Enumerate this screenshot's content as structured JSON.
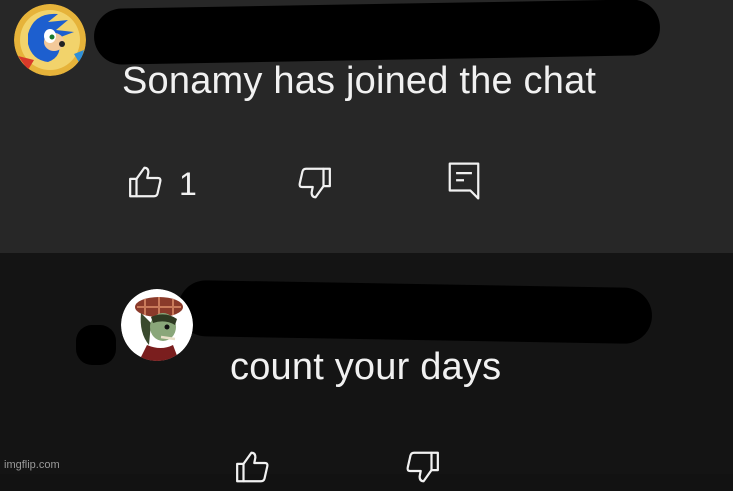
{
  "comments": [
    {
      "text": "Sonamy has joined the chat",
      "like_count": "1",
      "avatar_icon": "sonic-avatar-icon"
    },
    {
      "text": "count your days",
      "avatar_icon": "character-avatar-icon"
    }
  ],
  "icons": {
    "like": "thumbs-up-icon",
    "dislike": "thumbs-down-icon",
    "reply": "reply-comment-icon"
  },
  "colors": {
    "top_background": "#272727",
    "bottom_background": "#141414",
    "text": "#f1f1f1"
  },
  "watermark": "imgflip.com"
}
